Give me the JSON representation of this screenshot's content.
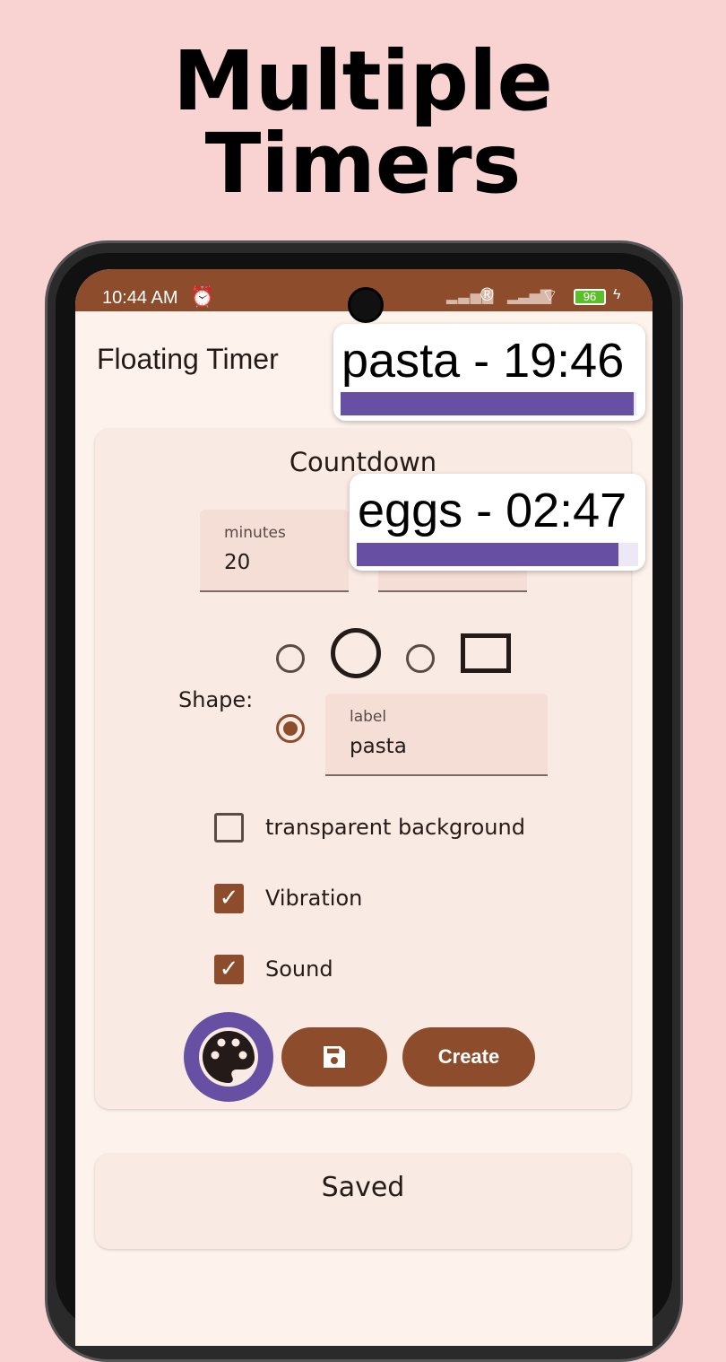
{
  "headline": {
    "line1": "Multiple",
    "line2": "Timers"
  },
  "status_bar": {
    "time": "10:44 AM",
    "battery": "96"
  },
  "app": {
    "title": "Floating Timer"
  },
  "countdown": {
    "title": "Countdown",
    "minutes_label": "minutes",
    "minutes_value": "20",
    "shape_label": "Shape:",
    "shape_selected": "label",
    "label_field": {
      "label": "label",
      "value": "pasta"
    },
    "checkboxes": [
      {
        "label": "transparent background",
        "checked": false
      },
      {
        "label": "Vibration",
        "checked": true
      },
      {
        "label": "Sound",
        "checked": true
      }
    ],
    "create_label": "Create"
  },
  "saved": {
    "title": "Saved"
  },
  "floating_timers": [
    {
      "text": "pasta - 19:46",
      "progress": 0.99
    },
    {
      "text": "eggs - 02:47",
      "progress": 0.93
    }
  ],
  "colors": {
    "primary": "#8d4c2c",
    "accent": "#6750a4",
    "background": "#f9d3d1"
  }
}
